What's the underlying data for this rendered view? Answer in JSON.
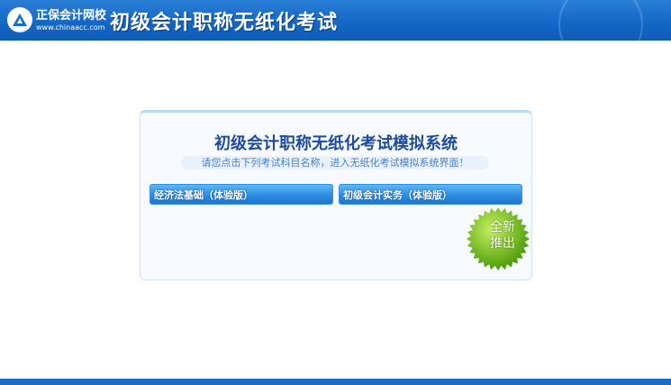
{
  "header": {
    "brand": "正保会计网校",
    "url": "www.chinaacc.com",
    "title": "初级会计职称无纸化考试"
  },
  "panel": {
    "title": "初级会计职称无纸化考试模拟系统",
    "subtitle": "请您点击下列考试科目名称，进入无纸化考试模拟系统界面！",
    "buttons": [
      {
        "label": "经济法基础（体验版）"
      },
      {
        "label": "初级会计实务（体验版）"
      }
    ],
    "badge": {
      "line1": "全新",
      "line2": "推出"
    }
  },
  "colors": {
    "header": "#1366c4",
    "title": "#1d4b9a",
    "badge": "#7cc11a"
  }
}
